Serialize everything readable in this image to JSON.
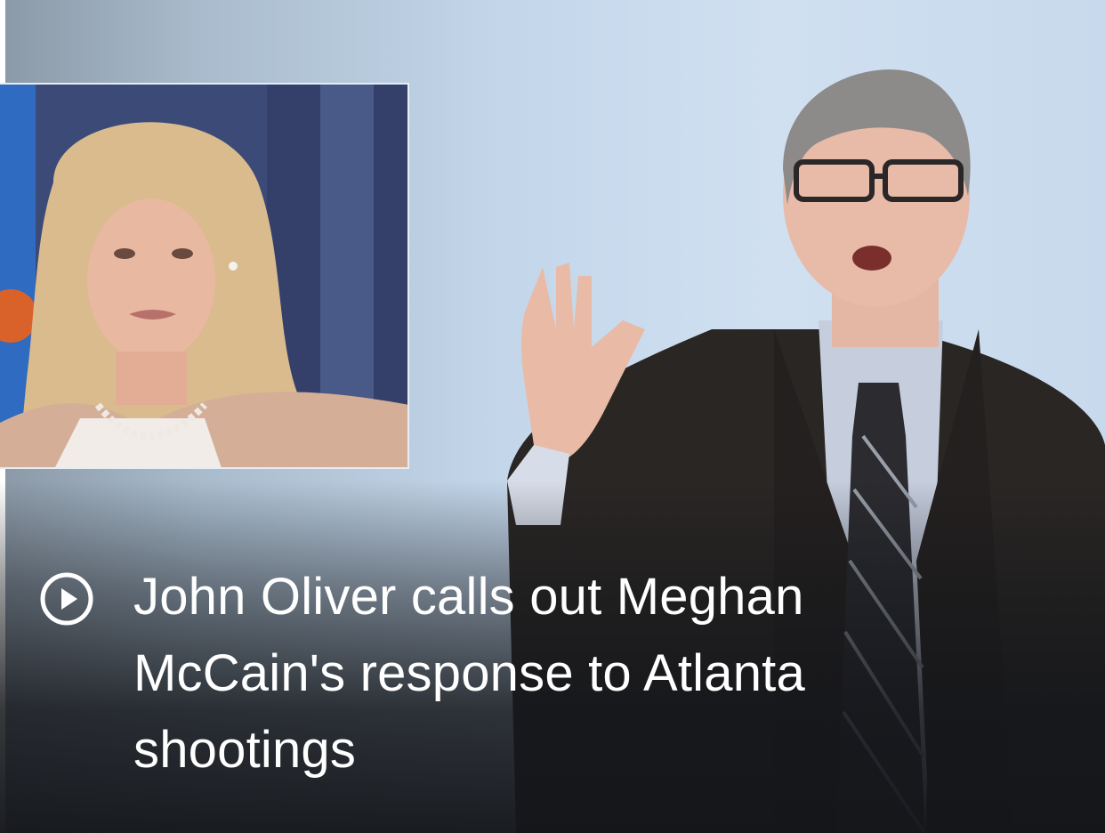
{
  "story": {
    "headline": "John Oliver calls out Meghan McCain's response to Atlanta shootings",
    "media_type_icon": "play-circle-icon"
  },
  "colors": {
    "caption_text": "#ffffff",
    "sky": "#c9dbee",
    "suit": "#2a2624"
  }
}
